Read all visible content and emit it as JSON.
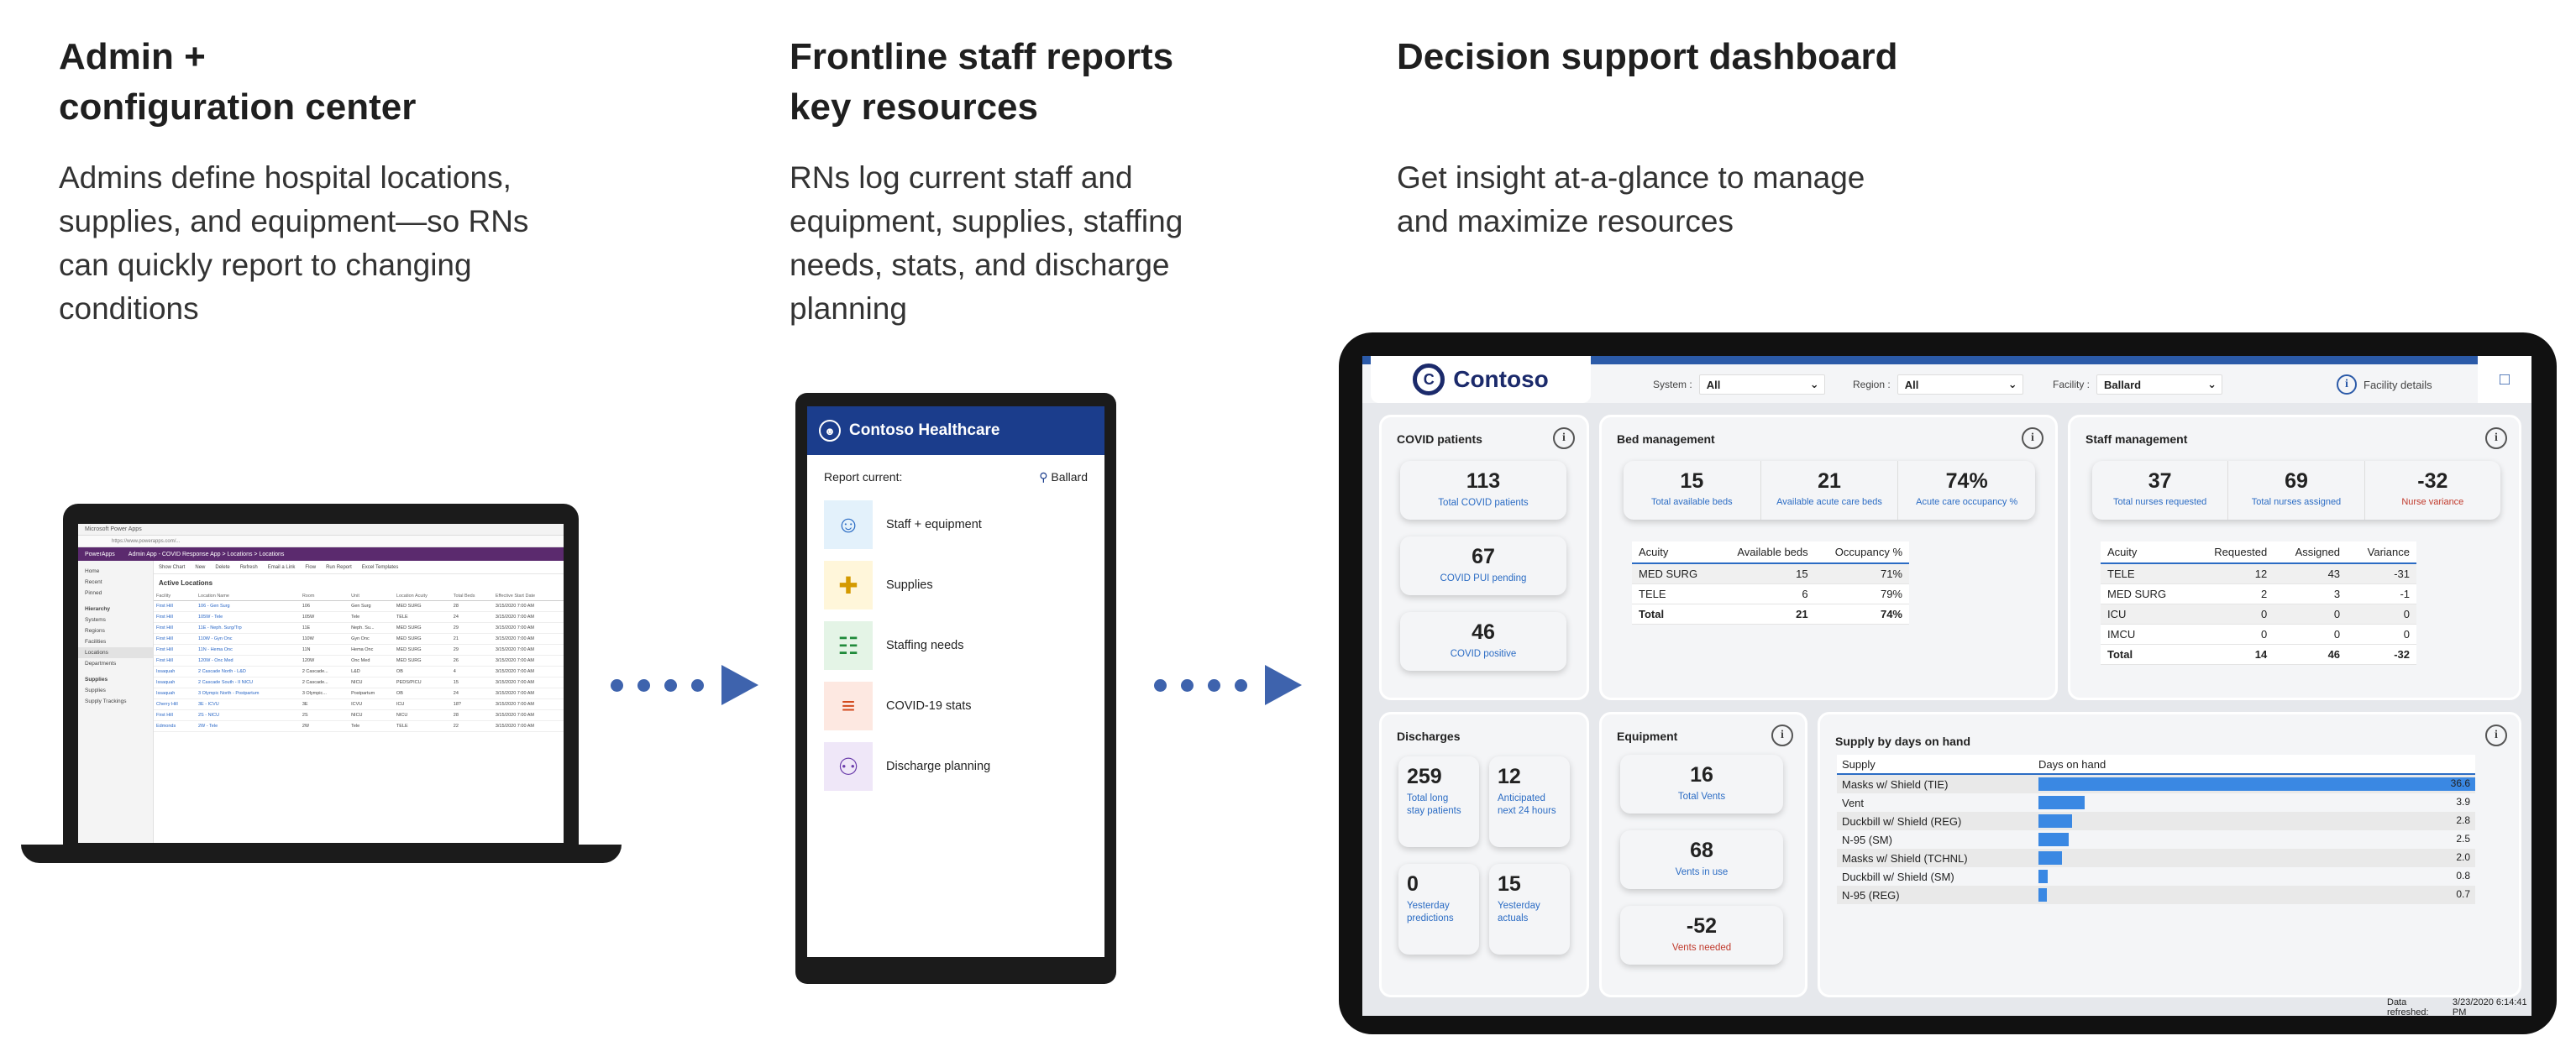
{
  "columns": [
    {
      "title_line1": "Admin +",
      "title_line2": "configuration center",
      "desc_lines": [
        "Admins define hospital locations,",
        "supplies, and equipment—so RNs",
        "can quickly report to changing",
        "conditions"
      ]
    },
    {
      "title_line1": "Frontline staff reports",
      "title_line2": "key resources",
      "desc_lines": [
        "RNs log current staff and",
        "equipment, supplies, staffing",
        "needs, stats, and discharge",
        "planning"
      ]
    },
    {
      "title_line1": "Decision support dashboard",
      "title_line2": "",
      "desc_lines": [
        "Get insight at-a-glance to manage",
        "and maximize resources"
      ]
    }
  ],
  "laptop": {
    "browser_tab": "Microsoft Power Apps",
    "url": "https://www.powerapps.com/...",
    "app_name": "PowerApps",
    "breadcrumb": "Admin App - COVID Response App  >  Locations  >  Locations",
    "commands": [
      "Show Chart",
      "New",
      "Delete",
      "Refresh",
      "Email a Link",
      "Flow",
      "Run Report",
      "Excel Templates"
    ],
    "nav": {
      "top": [
        "Home",
        "Recent",
        "Pinned"
      ],
      "hierarchy_label": "Hierarchy",
      "hierarchy": [
        "Systems",
        "Regions",
        "Facilities",
        "Locations",
        "Departments"
      ],
      "supplies_label": "Supplies",
      "supplies": [
        "Supplies",
        "Supply Trackings"
      ]
    },
    "view_title": "Active Locations",
    "table_headers": [
      "Facility",
      "Location Name",
      "Room",
      "Unit",
      "Location Acuity",
      "Total Beds",
      "Effective Start Date"
    ],
    "rows": [
      [
        "First Hill",
        "106 - Gen Surg",
        "106",
        "Gen Surg",
        "MED SURG",
        "28",
        "3/15/2020 7:00 AM"
      ],
      [
        "First Hill",
        "105W - Tele",
        "105W",
        "Tele",
        "TELE",
        "24",
        "3/15/2020 7:00 AM"
      ],
      [
        "First Hill",
        "11E - Neph. Surg/Trp",
        "11E",
        "Neph. Su...",
        "MED SURG",
        "29",
        "3/15/2020 7:00 AM"
      ],
      [
        "First Hill",
        "110W - Gyn Onc",
        "110W",
        "Gyn Onc",
        "MED SURG",
        "21",
        "3/15/2020 7:00 AM"
      ],
      [
        "First Hill",
        "11N - Hema Onc",
        "11N",
        "Hema Onc",
        "MED SURG",
        "29",
        "3/15/2020 7:00 AM"
      ],
      [
        "First Hill",
        "120W - Onc Med",
        "120W",
        "Onc Med",
        "MED SURG",
        "26",
        "3/15/2020 7:00 AM"
      ],
      [
        "Issaquah",
        "2 Cascade North - L&D",
        "2 Cascade...",
        "L&D",
        "OB",
        "4",
        "3/15/2020 7:00 AM"
      ],
      [
        "Issaquah",
        "2 Cascade South - II NICU",
        "2 Cascade...",
        "NICU",
        "PEDS/PICU",
        "15",
        "3/15/2020 7:00 AM"
      ],
      [
        "Issaquah",
        "3 Olympic North - Postpartum",
        "3 Olympic...",
        "Postpartum",
        "OB",
        "24",
        "3/15/2020 7:00 AM"
      ],
      [
        "Cherry Hill",
        "3E - ICVU",
        "3E",
        "ICVU",
        "ICU",
        "18?",
        "3/15/2020 7:00 AM"
      ],
      [
        "First Hill",
        "2S - NICU",
        "2S",
        "NICU",
        "NICU",
        "28",
        "3/15/2020 7:00 AM"
      ],
      [
        "Edmonds",
        "2W - Tele",
        "2W",
        "Tele",
        "TELE",
        "22",
        "3/15/2020 7:00 AM"
      ]
    ]
  },
  "phone": {
    "app_title": "Contoso Healthcare",
    "report_label": "Report current:",
    "facility": "Ballard",
    "items": [
      {
        "label": "Staff + equipment",
        "icon": "staff-equipment-icon",
        "color": "#2b6cc4",
        "bg": "#e3f1fb",
        "glyph": "☺"
      },
      {
        "label": "Supplies",
        "icon": "supplies-icon",
        "color": "#d49a00",
        "bg": "#fff6da",
        "glyph": "✚"
      },
      {
        "label": "Staffing needs",
        "icon": "staffing-needs-icon",
        "color": "#1f8a3a",
        "bg": "#e4f4e6",
        "glyph": "☷"
      },
      {
        "label": "COVID-19 stats",
        "icon": "covid-stats-icon",
        "color": "#d24a1e",
        "bg": "#fde8e1",
        "glyph": "≡"
      },
      {
        "label": "Discharge planning",
        "icon": "discharge-planning-icon",
        "color": "#6a3cab",
        "bg": "#efe7f8",
        "glyph": "⚇"
      }
    ]
  },
  "dashboard": {
    "brand": "Contoso",
    "filters": [
      {
        "label": "System :",
        "value": "All"
      },
      {
        "label": "Region :",
        "value": "All"
      },
      {
        "label": "Facility :",
        "value": "Ballard"
      }
    ],
    "facility_details": "Facility details",
    "covid": {
      "title": "COVID patients",
      "kpis": [
        {
          "value": "113",
          "label": "Total COVID patients"
        },
        {
          "value": "67",
          "label": "COVID PUI pending"
        },
        {
          "value": "46",
          "label": "COVID positive"
        }
      ]
    },
    "beds": {
      "title": "Bed management",
      "kpis": [
        {
          "value": "15",
          "label": "Total available beds"
        },
        {
          "value": "21",
          "label": "Available acute care beds"
        },
        {
          "value": "74%",
          "label": "Acute care occupancy %"
        }
      ],
      "headers": [
        "Acuity",
        "Available beds",
        "Occupancy %"
      ],
      "rows": [
        [
          "MED SURG",
          "15",
          "71%"
        ],
        [
          "TELE",
          "6",
          "79%"
        ]
      ],
      "total": [
        "Total",
        "21",
        "74%"
      ]
    },
    "staff": {
      "title": "Staff management",
      "kpis": [
        {
          "value": "37",
          "label": "Total nurses requested",
          "red": false
        },
        {
          "value": "69",
          "label": "Total nurses assigned",
          "red": false
        },
        {
          "value": "-32",
          "label": "Nurse variance",
          "red": true
        }
      ],
      "headers": [
        "Acuity",
        "Requested",
        "Assigned",
        "Variance"
      ],
      "rows": [
        [
          "TELE",
          "12",
          "43",
          "-31"
        ],
        [
          "MED SURG",
          "2",
          "3",
          "-1"
        ],
        [
          "ICU",
          "0",
          "0",
          "0"
        ],
        [
          "IMCU",
          "0",
          "0",
          "0"
        ]
      ],
      "total": [
        "Total",
        "14",
        "46",
        "-32"
      ]
    },
    "discharges": {
      "title": "Discharges",
      "kpis": [
        {
          "value": "259",
          "label_lines": [
            "Total long",
            "stay patients"
          ]
        },
        {
          "value": "12",
          "label_lines": [
            "Anticipated",
            "next 24 hours"
          ]
        },
        {
          "value": "0",
          "label_lines": [
            "Yesterday",
            "predictions"
          ]
        },
        {
          "value": "15",
          "label_lines": [
            "Yesterday",
            "actuals"
          ]
        }
      ]
    },
    "equipment": {
      "title": "Equipment",
      "kpis": [
        {
          "value": "16",
          "label": "Total Vents",
          "red": false
        },
        {
          "value": "68",
          "label": "Vents in use",
          "red": false
        },
        {
          "value": "-52",
          "label": "Vents needed",
          "red": true
        }
      ]
    },
    "supply": {
      "title": "Supply by days on hand",
      "col_supply": "Supply",
      "col_days": "Days on hand",
      "max": 36.6,
      "rows": [
        {
          "name": "Masks w/ Shield (TIE)",
          "value": 36.6
        },
        {
          "name": "Vent",
          "value": 3.9
        },
        {
          "name": "Duckbill w/ Shield (REG)",
          "value": 2.8
        },
        {
          "name": "N-95 (SM)",
          "value": 2.5
        },
        {
          "name": "Masks w/ Shield (TCHNL)",
          "value": 2.0
        },
        {
          "name": "Duckbill w/ Shield (SM)",
          "value": 0.8
        },
        {
          "name": "N-95 (REG)",
          "value": 0.7
        }
      ]
    },
    "refresh_label": "Data refreshed:",
    "refresh_value": "3/23/2020 6:14:41 PM"
  },
  "colors": {
    "accent": "#3e63ad",
    "dashboard_blue": "#2b5aa8",
    "bar": "#3a88e3",
    "phone_header": "#1b3d8c"
  }
}
